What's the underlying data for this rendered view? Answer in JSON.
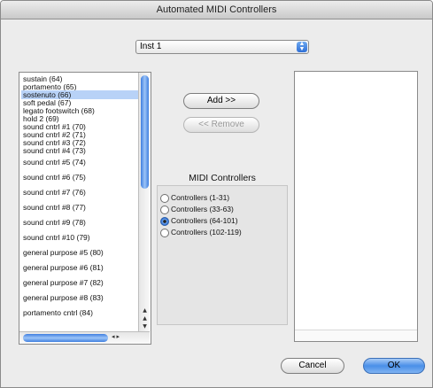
{
  "window": {
    "title": "Automated MIDI Controllers"
  },
  "instrument_popup": {
    "selected": "Inst 1"
  },
  "controller_list": {
    "items": [
      "sustain (64)",
      "portamento (65)",
      "sostenuto (66)",
      "soft pedal (67)",
      "legato footswitch (68)",
      "hold 2 (69)",
      "sound cntrl #1 (70)",
      "sound cntrl #2 (71)",
      "sound cntrl #3 (72)",
      "sound cntrl #4 (73)",
      "sound cntrl #5 (74)",
      "sound cntrl #6 (75)",
      "sound cntrl #7 (76)",
      "sound cntrl #8 (77)",
      "sound cntrl #9 (78)",
      "sound cntrl #10 (79)",
      "general purpose #5 (80)",
      "general purpose #6 (81)",
      "general purpose #7 (82)",
      "general purpose #8 (83)",
      "portamento cntrl (84)"
    ],
    "selected_index": 2
  },
  "buttons": {
    "add": "Add >>",
    "remove": "<< Remove",
    "cancel": "Cancel",
    "ok": "OK"
  },
  "midi_group": {
    "title": "MIDI Controllers",
    "options": [
      "Controllers (1-31)",
      "Controllers (33-63)",
      "Controllers (64-101)",
      "Controllers (102-119)"
    ],
    "selected_index": 2
  }
}
